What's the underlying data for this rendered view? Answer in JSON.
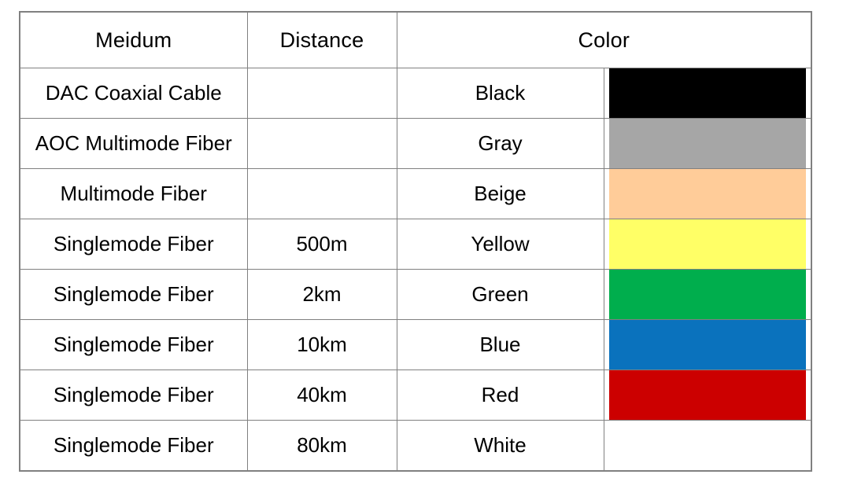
{
  "table": {
    "headers": {
      "medium": "Meidum",
      "distance": "Distance",
      "color": "Color"
    },
    "rows": [
      {
        "medium": "DAC Coaxial Cable",
        "distance": "",
        "color_name": "Black",
        "color_hex": "#000000"
      },
      {
        "medium": "AOC Multimode Fiber",
        "distance": "",
        "color_name": "Gray",
        "color_hex": "#A6A6A6"
      },
      {
        "medium": "Multimode Fiber",
        "distance": "",
        "color_name": "Beige",
        "color_hex": "#FFCC99"
      },
      {
        "medium": "Singlemode Fiber",
        "distance": "500m",
        "color_name": "Yellow",
        "color_hex": "#FFFF66"
      },
      {
        "medium": "Singlemode Fiber",
        "distance": "2km",
        "color_name": "Green",
        "color_hex": "#00AE4D"
      },
      {
        "medium": "Singlemode Fiber",
        "distance": "10km",
        "color_name": "Blue",
        "color_hex": "#0A72BD"
      },
      {
        "medium": "Singlemode Fiber",
        "distance": "40km",
        "color_name": "Red",
        "color_hex": "#CC0000"
      },
      {
        "medium": "Singlemode Fiber",
        "distance": "80km",
        "color_name": "White",
        "color_hex": "#FFFFFF"
      }
    ]
  }
}
